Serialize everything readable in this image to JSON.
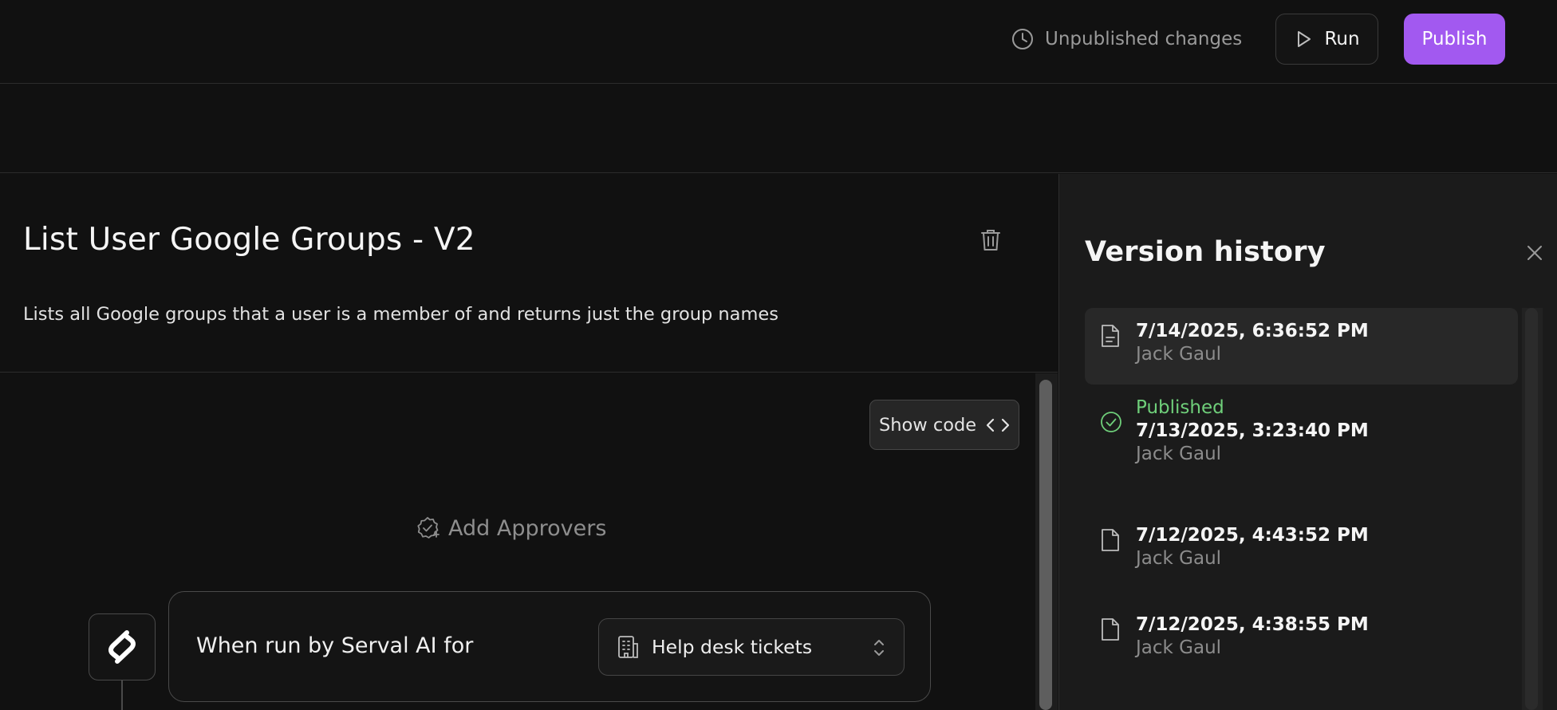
{
  "topbar": {
    "status_text": "Unpublished changes",
    "run_label": "Run",
    "publish_label": "Publish",
    "accent_color": "#a259f0"
  },
  "workflow": {
    "title": "List User Google Groups - V2",
    "description": "Lists all Google groups that a user is a member of and returns just the group names"
  },
  "canvas": {
    "show_code_label": "Show code",
    "add_approvers_label": "Add Approvers",
    "trigger_label": "When run by Serval AI for",
    "trigger_select_value": "Help desk tickets"
  },
  "version_history": {
    "title": "Version history",
    "versions": [
      {
        "status": "",
        "date": "7/14/2025, 6:36:52 PM",
        "author": "Jack Gaul",
        "selected": true,
        "icon": "document-lines-icon"
      },
      {
        "status": "Published",
        "date": "7/13/2025, 3:23:40 PM",
        "author": "Jack Gaul",
        "selected": false,
        "icon": "check-circle-icon"
      },
      {
        "status": "",
        "date": "7/12/2025, 4:43:52 PM",
        "author": "Jack Gaul",
        "selected": false,
        "icon": "document-icon"
      },
      {
        "status": "",
        "date": "7/12/2025, 4:38:55 PM",
        "author": "Jack Gaul",
        "selected": false,
        "icon": "document-icon"
      }
    ]
  }
}
